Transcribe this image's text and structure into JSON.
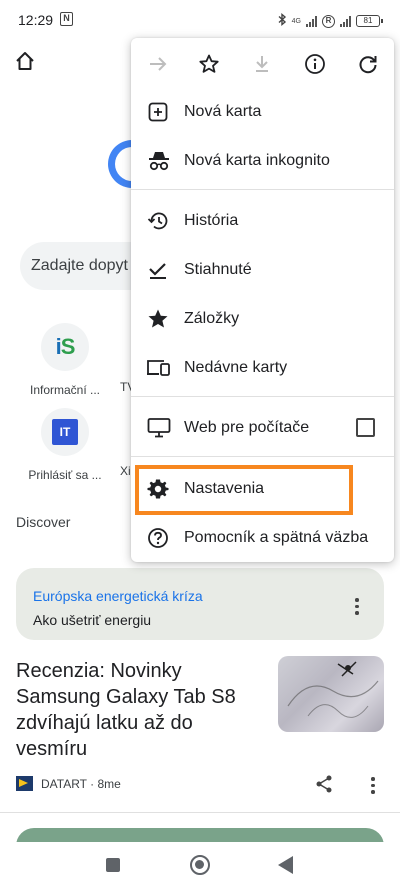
{
  "status_bar": {
    "time": "12:29",
    "nfc_glyph": "N",
    "network_label": "4G",
    "roaming_glyph": "R",
    "battery": "81"
  },
  "background": {
    "search_placeholder": "Zadajte dopyt",
    "shortcuts": [
      {
        "label": "Informační ...",
        "logo_text": "iS"
      },
      {
        "label": "Prihlásiť sa ...",
        "logo_text": "IT"
      }
    ],
    "peek_labels": [
      "TV",
      "Xi"
    ],
    "discover_label": "Discover",
    "promo_card": {
      "title": "Európska energetická kríza",
      "subtitle": "Ako ušetriť energiu"
    },
    "article": {
      "title": "Recenzia: Novinky Samsung Galaxy Tab S8 zdvíhajú latku až do vesmíru",
      "source": "DATART · 8me"
    }
  },
  "menu": {
    "toolbar": [
      {
        "icon": "forward-arrow-icon",
        "enabled": false
      },
      {
        "icon": "star-outline-icon",
        "enabled": true
      },
      {
        "icon": "download-icon",
        "enabled": false
      },
      {
        "icon": "info-icon",
        "enabled": true
      },
      {
        "icon": "reload-icon",
        "enabled": true
      }
    ],
    "items": [
      {
        "label": "Nová karta",
        "icon": "new-tab-icon"
      },
      {
        "label": "Nová karta inkognito",
        "icon": "incognito-icon"
      },
      {
        "label": "História",
        "icon": "history-icon"
      },
      {
        "label": "Stiahnuté",
        "icon": "downloads-check-icon"
      },
      {
        "label": "Záložky",
        "icon": "bookmarks-star-icon"
      },
      {
        "label": "Nedávne karty",
        "icon": "recent-tabs-icon"
      },
      {
        "label": "Web pre počítače",
        "icon": "desktop-icon",
        "checked": false
      },
      {
        "label": "Nastavenia",
        "icon": "gear-icon",
        "highlighted": true
      },
      {
        "label": "Pomocník a spätná väzba",
        "icon": "help-icon"
      }
    ]
  },
  "colors": {
    "highlight": "#f7871f",
    "link_blue": "#1a73e8",
    "promo_bg": "#e8ebe6"
  }
}
